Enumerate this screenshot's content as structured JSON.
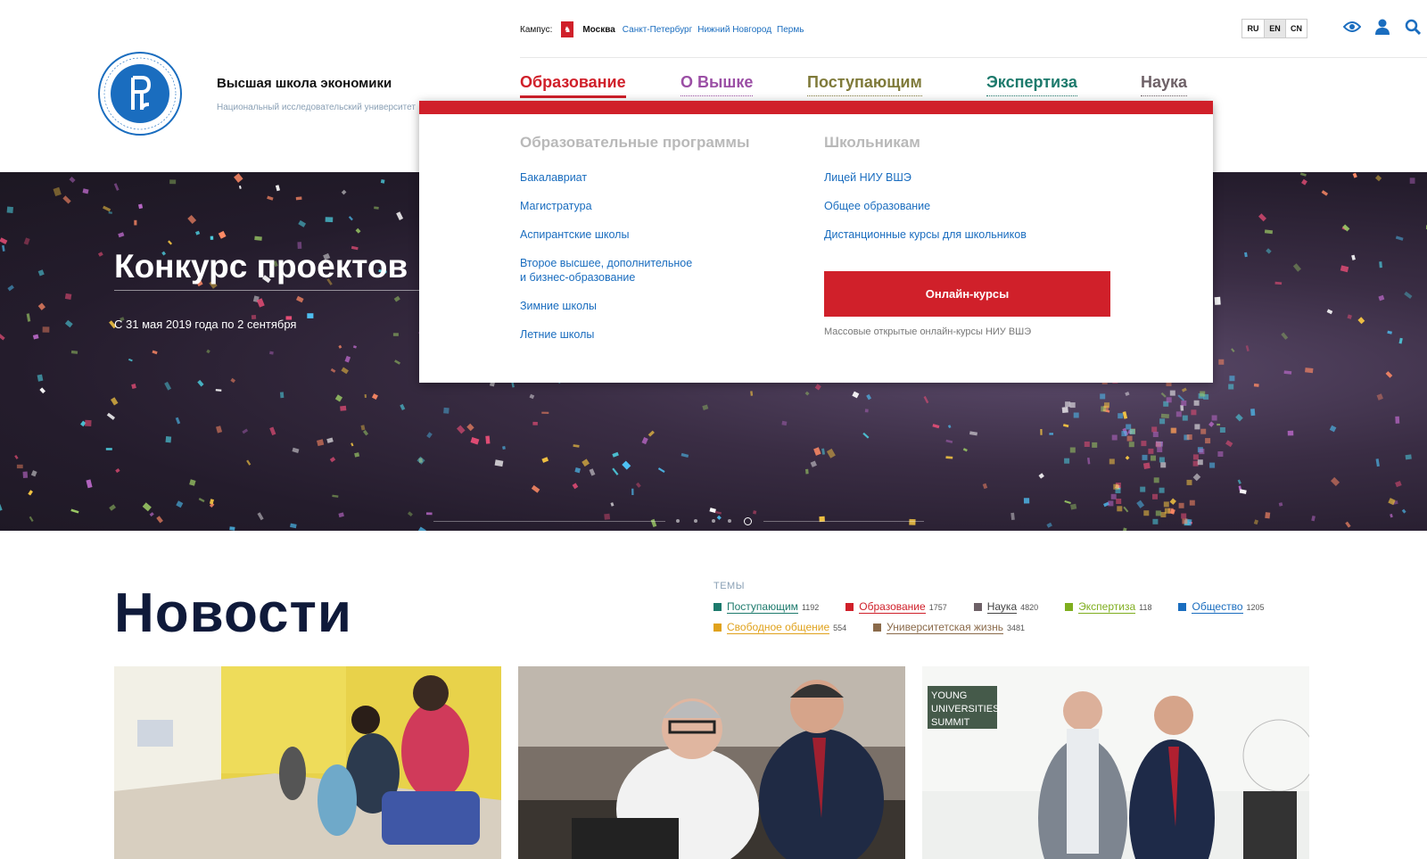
{
  "header": {
    "brand_title": "Высшая школа экономики",
    "brand_subtitle": "Национальный исследовательский университет",
    "campus_label": "Кампус:",
    "campus_current": "Москва",
    "campus_others": [
      "Санкт-Петербург",
      "Нижний Новгород",
      "Пермь"
    ],
    "languages": [
      "RU",
      "EN",
      "CN"
    ],
    "active_language": "EN",
    "icons": [
      "eye-icon",
      "user-icon",
      "search-icon"
    ]
  },
  "nav": {
    "items": [
      {
        "label": "Образование",
        "color": "#d0202a"
      },
      {
        "label": "О Вышке",
        "color": "#9b4fa5"
      },
      {
        "label": "Поступающим",
        "color": "#7f7a3a"
      },
      {
        "label": "Экспертиза",
        "color": "#1d7a6c"
      },
      {
        "label": "Наука",
        "color": "#6e6167"
      }
    ],
    "active": "Образование"
  },
  "dropdown": {
    "col1": {
      "heading": "Образовательные программы",
      "links": [
        "Бакалавриат",
        "Магистратура",
        "Аспирантские школы",
        "Второе высшее, дополнительное",
        "и бизнес-образование",
        "Зимние школы",
        "Летние школы"
      ]
    },
    "col2": {
      "heading": "Школьникам",
      "links": [
        "Лицей НИУ ВШЭ",
        "Общее образование",
        "Дистанционные курсы для школьников"
      ]
    },
    "cta_label": "Онлайн-курсы",
    "cta_note": "Массовые открытые онлайн-курсы НИУ ВШЭ"
  },
  "hero": {
    "title": "Конкурс проектов н",
    "dates": "С 31 мая 2019 года по 2 сентября",
    "slides": 5,
    "active_slide": 5
  },
  "news": {
    "title": "Новости",
    "topics_label": "ТЕМЫ",
    "topics": [
      {
        "name": "Поступающим",
        "count": "1192",
        "color": "#1d7a6c"
      },
      {
        "name": "Образование",
        "count": "1757",
        "color": "#d0202a"
      },
      {
        "name": "Наука",
        "count": "4820",
        "color": "#6e6167"
      },
      {
        "name": "Экспертиза",
        "count": "118",
        "color": "#7fae1f"
      },
      {
        "name": "Общество",
        "count": "1205",
        "color": "#1a6dbf"
      },
      {
        "name": "Свободное общение",
        "count": "554",
        "color": "#e0a21c"
      },
      {
        "name": "Университетская жизнь",
        "count": "3481",
        "color": "#8a6a4a"
      }
    ],
    "summit_banner": [
      "YOUNG",
      "UNIVERSITIES",
      "SUMMIT"
    ]
  },
  "colors": {
    "brand_blue": "#1a6dbf",
    "brand_red": "#d0202a",
    "navy": "#0f1a3a"
  }
}
